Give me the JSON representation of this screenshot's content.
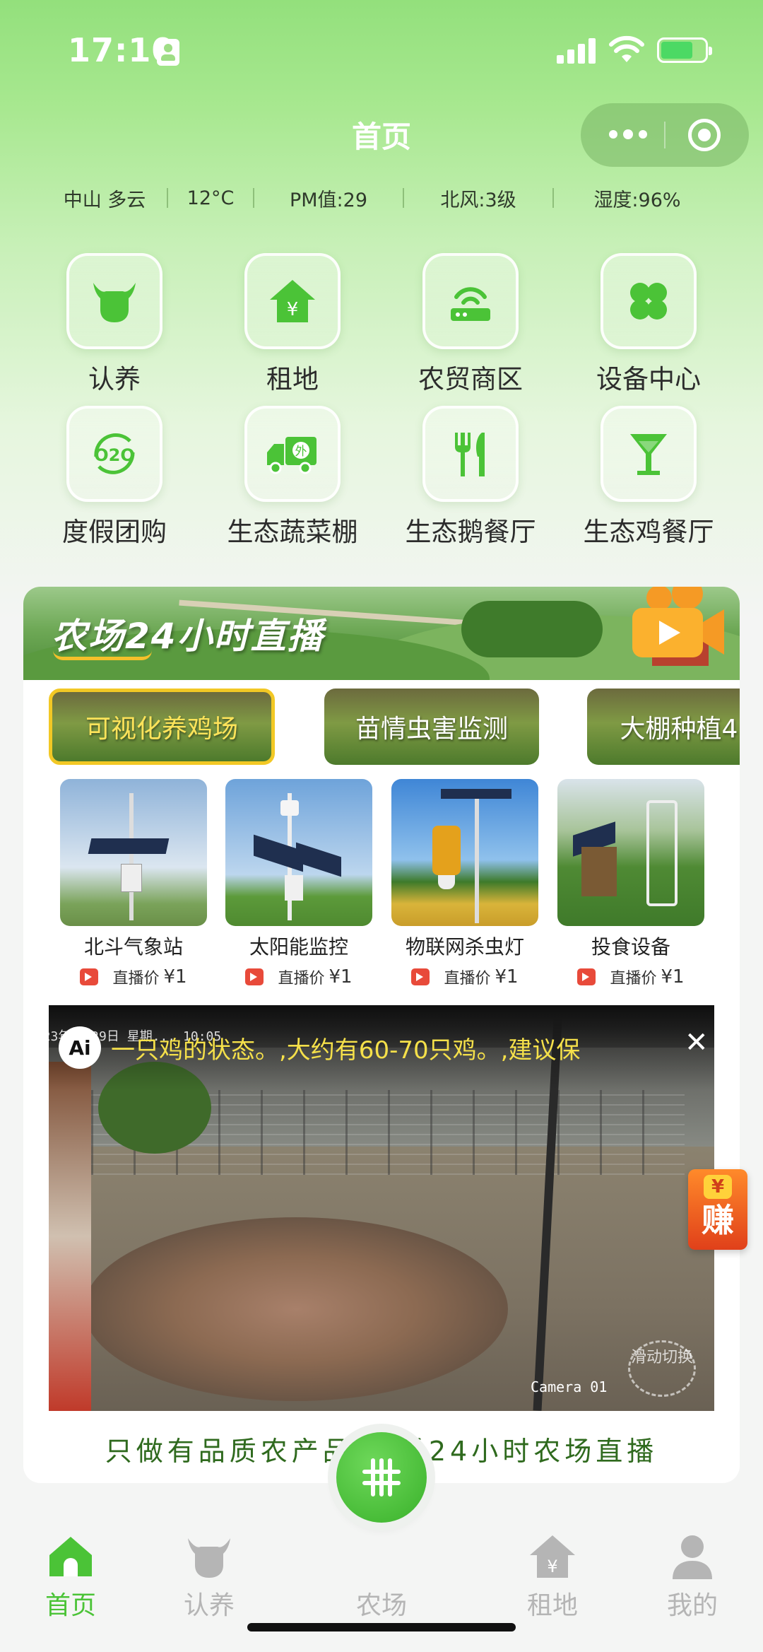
{
  "status_bar": {
    "time": "17:10"
  },
  "nav": {
    "title": "首页"
  },
  "weather": [
    "中山 多云",
    "12°C",
    "PM值:29",
    "北风:3级",
    "湿度:96%"
  ],
  "grid": [
    {
      "label": "认养",
      "icon": "cow-icon"
    },
    {
      "label": "租地",
      "icon": "house-yen-icon"
    },
    {
      "label": "农贸商区",
      "icon": "router-icon"
    },
    {
      "label": "设备中心",
      "icon": "clover-icon"
    },
    {
      "label": "度假团购",
      "icon": "o2o-icon"
    },
    {
      "label": "生态蔬菜棚",
      "icon": "delivery-truck-icon"
    },
    {
      "label": "生态鹅餐厅",
      "icon": "fork-knife-icon"
    },
    {
      "label": "生态鸡餐厅",
      "icon": "cocktail-icon"
    }
  ],
  "live": {
    "banner_title": "农场24小时直播",
    "tabs": [
      "可视化养鸡场",
      "苗情虫害监测",
      "大棚种植4"
    ],
    "products": [
      {
        "name": "北斗气象站",
        "price_label": "直播价",
        "price": "¥1"
      },
      {
        "name": "太阳能监控",
        "price_label": "直播价",
        "price": "¥1"
      },
      {
        "name": "物联网杀虫灯",
        "price_label": "直播价",
        "price": "¥1"
      },
      {
        "name": "投食设备",
        "price_label": "直播价",
        "price": "¥1"
      }
    ],
    "video": {
      "ai_badge": "Ai",
      "ai_text": "一只鸡的状态。,大约有60-70只鸡。,建议保",
      "close": "✕",
      "timestamp": "2023年3月29日 星期... 10:05",
      "camera": "Camera 01",
      "watermark": "滑动切换"
    },
    "slogan": "只做有品质农产品 来看24小时农场直播"
  },
  "earn": {
    "yen": "¥",
    "text": "赚"
  },
  "tabbar": [
    {
      "label": "首页",
      "icon": "home-icon",
      "active": true
    },
    {
      "label": "认养",
      "icon": "cow-icon",
      "active": false
    },
    {
      "label": "农场",
      "icon": "farm-grid-icon",
      "active": false
    },
    {
      "label": "租地",
      "icon": "house-yen-icon",
      "active": false
    },
    {
      "label": "我的",
      "icon": "user-icon",
      "active": false
    }
  ],
  "colors": {
    "accent": "#4bc337",
    "header_green": "#93e07c",
    "highlight": "#f2c825"
  }
}
